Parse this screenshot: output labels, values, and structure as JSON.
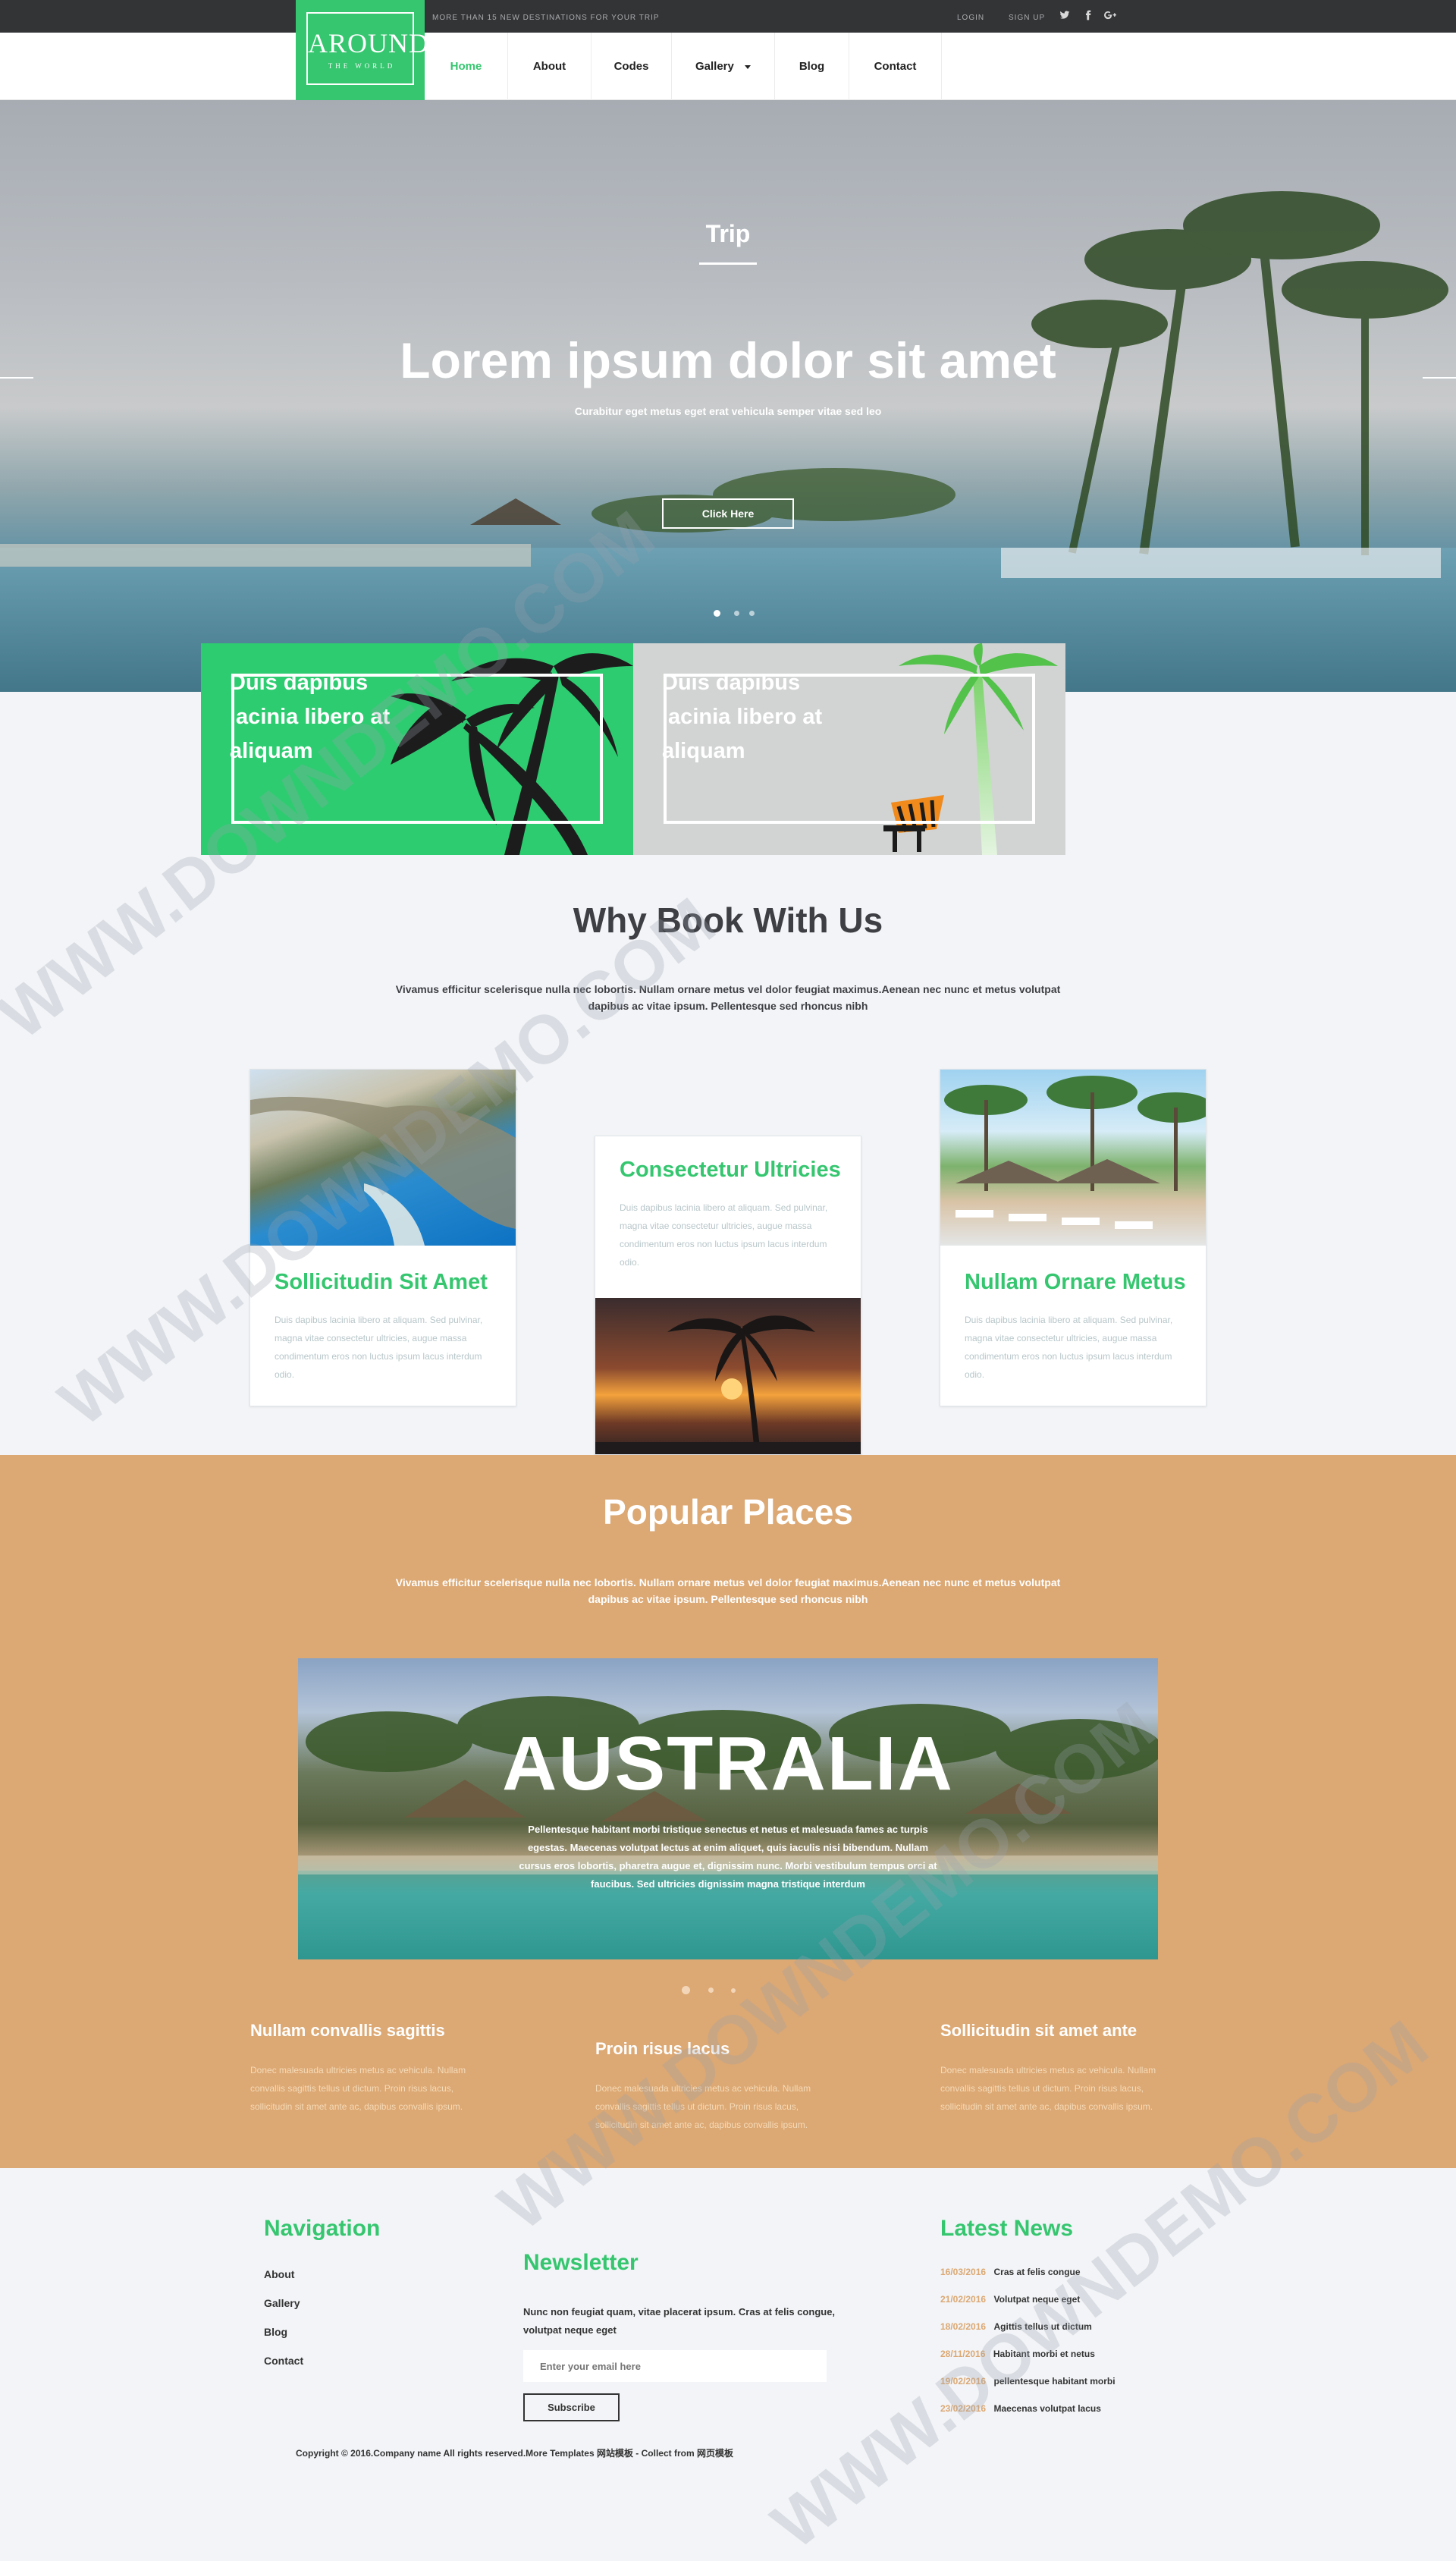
{
  "topbar": {
    "tagline": "MORE THAN 15 NEW DESTINATIONS FOR YOUR TRIP",
    "login": "LOGIN",
    "signup": "SIGN UP",
    "social": [
      "twitter-icon",
      "facebook-icon",
      "google-plus-icon"
    ]
  },
  "logo": {
    "title": "AROUND",
    "subtitle": "THE WORLD"
  },
  "nav": {
    "items": [
      {
        "label": "Home"
      },
      {
        "label": "About"
      },
      {
        "label": "Codes"
      },
      {
        "label": "Gallery"
      },
      {
        "label": "Blog"
      },
      {
        "label": "Contact"
      }
    ],
    "active_color": "#35c66f"
  },
  "hero": {
    "label": "Trip",
    "title": "Lorem ipsum dolor sit amet",
    "subtitle": "Curabitur eget metus eget erat vehicula semper vitae sed leo",
    "button": "Click Here",
    "active_slide": 1,
    "slide_count": 3
  },
  "promos": [
    {
      "text": "Duis dapibus lacinia libero at aliquam",
      "bg": "#2ecc71"
    },
    {
      "text": "Duis dapibus lacinia libero at aliquam",
      "bg": "#d2d4d3"
    }
  ],
  "why": {
    "title": "Why Book With Us",
    "desc": "Vivamus efficitur scelerisque nulla nec lobortis. Nullam ornare metus vel dolor feugiat maximus.Aenean nec nunc et metus volutpat dapibus ac vitae ipsum. Pellentesque sed rhoncus nibh",
    "cards": [
      {
        "title": "Sollicitudin Sit Amet",
        "body": "Duis dapibus lacinia libero at aliquam. Sed pulvinar, magna vitae consectetur ultricies, augue massa condimentum eros non luctus ipsum lacus interdum odio."
      },
      {
        "title": "Consectetur Ultricies",
        "body": "Duis dapibus lacinia libero at aliquam. Sed pulvinar, magna vitae consectetur ultricies, augue massa condimentum eros non luctus ipsum lacus interdum odio."
      },
      {
        "title": "Nullam Ornare Metus",
        "body": "Duis dapibus lacinia libero at aliquam. Sed pulvinar, magna vitae consectetur ultricies, augue massa condimentum eros non luctus ipsum lacus interdum odio."
      }
    ]
  },
  "popular": {
    "title": "Popular Places",
    "desc": "Vivamus efficitur scelerisque nulla nec lobortis. Nullam ornare metus vel dolor feugiat maximus.Aenean nec nunc et metus volutpat dapibus ac vitae ipsum. Pellentesque sed rhoncus nibh",
    "slide": {
      "title": "AUSTRALIA",
      "desc": "Pellentesque habitant morbi tristique senectus et netus et malesuada fames ac turpis egestas. Maecenas volutpat lectus at enim aliquet, quis iaculis nisi bibendum. Nullam cursus eros lobortis, pharetra augue et, dignissim nunc. Morbi vestibulum tempus orci at faucibus. Sed ultricies dignissim magna tristique interdum"
    },
    "bg": "#dca873",
    "columns": [
      {
        "title": "Nullam convallis sagittis",
        "body": "Donec malesuada ultricies metus ac vehicula. Nullam convallis sagittis tellus ut dictum. Proin risus lacus, sollicitudin sit amet ante ac, dapibus convallis ipsum."
      },
      {
        "title": "Proin risus lacus",
        "body": "Donec malesuada ultricies metus ac vehicula. Nullam convallis sagittis tellus ut dictum. Proin risus lacus, sollicitudin sit amet ante ac, dapibus convallis ipsum."
      },
      {
        "title": "Sollicitudin sit amet ante",
        "body": "Donec malesuada ultricies metus ac vehicula. Nullam convallis sagittis tellus ut dictum. Proin risus lacus, sollicitudin sit amet ante ac, dapibus convallis ipsum."
      }
    ]
  },
  "footer": {
    "nav_title": "Navigation",
    "nav_links": [
      "About",
      "Gallery",
      "Blog",
      "Contact"
    ],
    "newsletter": {
      "title": "Newsletter",
      "desc": "Nunc non feugiat quam, vitae placerat ipsum. Cras at felis congue, volutpat neque eget",
      "placeholder": "Enter your email here",
      "button": "Subscribe"
    },
    "news_title": "Latest News",
    "news": [
      {
        "date": "16/03/2016",
        "text": "Cras at felis congue"
      },
      {
        "date": "21/02/2016",
        "text": "Volutpat neque eget"
      },
      {
        "date": "18/02/2016",
        "text": "Agittis tellus ut dictum"
      },
      {
        "date": "28/11/2016",
        "text": "Habitant morbi et netus"
      },
      {
        "date": "19/02/2016",
        "text": "pellentesque habitant morbi"
      },
      {
        "date": "23/02/2016",
        "text": "Maecenas volutpat lacus"
      }
    ],
    "copyright": "Copyright © 2016.Company name All rights reserved.More Templates 网站模板 - Collect from 网页模板"
  },
  "watermark": "WWW.DOWNDEMO.COM"
}
